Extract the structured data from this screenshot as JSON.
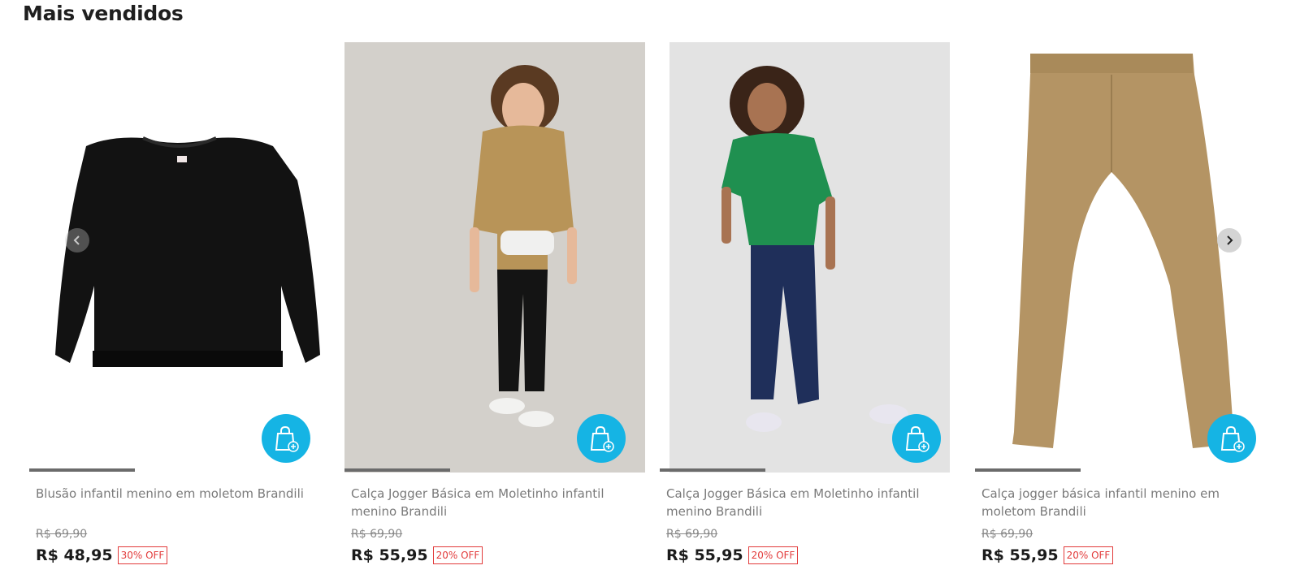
{
  "section": {
    "title": "Mais vendidos"
  },
  "products": [
    {
      "name": "Blusão infantil menino em moletom Brandili",
      "old_price": "R$ 69,90",
      "price": "R$ 48,95",
      "discount": "30% OFF"
    },
    {
      "name": "Calça Jogger Básica em Moletinho infantil menino Brandili",
      "old_price": "R$ 69,90",
      "price": "R$ 55,95",
      "discount": "20% OFF"
    },
    {
      "name": "Calça Jogger Básica em Moletinho infantil menino Brandili",
      "old_price": "R$ 69,90",
      "price": "R$ 55,95",
      "discount": "20% OFF"
    },
    {
      "name": "Calça jogger básica infantil menino em moletom Brandili",
      "old_price": "R$ 69,90",
      "price": "R$ 55,95",
      "discount": "20% OFF"
    }
  ],
  "icons": {
    "add_to_bag": "shopping-bag-plus-icon",
    "prev": "chevron-left-icon",
    "next": "chevron-right-icon"
  },
  "colors": {
    "accent": "#15b4e4",
    "discount": "#e23b3b"
  }
}
